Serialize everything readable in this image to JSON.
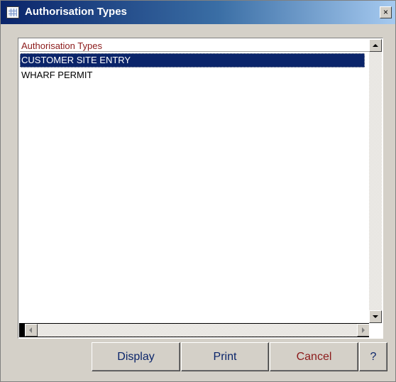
{
  "window": {
    "title": "Authorisation Types",
    "icon": "grid-icon",
    "close_label": "×"
  },
  "list": {
    "header": "Authorisation Types",
    "items": [
      {
        "label": "CUSTOMER SITE ENTRY",
        "selected": true
      },
      {
        "label": "WHARF PERMIT",
        "selected": false
      }
    ]
  },
  "buttons": {
    "display": "Display",
    "print": "Print",
    "cancel": "Cancel",
    "help": "?"
  },
  "colors": {
    "title_gradient_start": "#0a246a",
    "title_gradient_end": "#a6caf0",
    "selection": "#0a246a",
    "header_text": "#8b1a1a",
    "cancel_text": "#8b1a1a",
    "button_text": "#0a246a",
    "face": "#d4d0c8"
  }
}
